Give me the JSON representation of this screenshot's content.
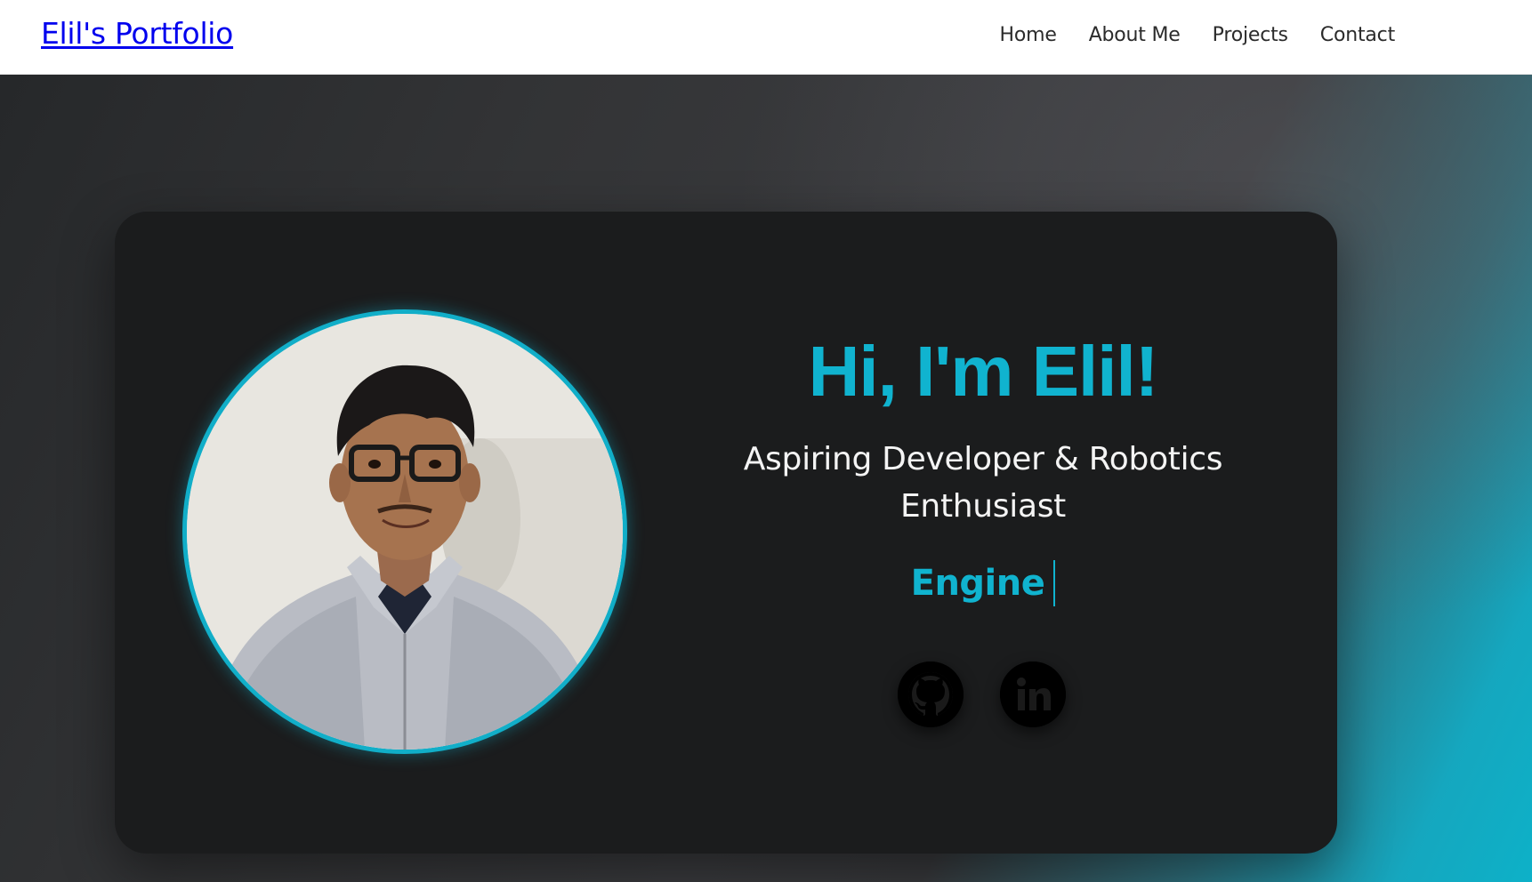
{
  "header": {
    "brand": "Elil's Portfolio",
    "nav": [
      "Home",
      "About Me",
      "Projects",
      "Contact"
    ]
  },
  "hero": {
    "greeting": "Hi, I'm Elil!",
    "tagline_line1": "Aspiring Developer & Robotics",
    "tagline_line2": "Enthusiast",
    "typed_text": "Engine"
  },
  "social": [
    {
      "icon": "github-icon"
    },
    {
      "icon": "linkedin-icon"
    }
  ],
  "colors": {
    "accent": "#10b3cf",
    "card_bg": "#1b1c1d",
    "link": "#0000ee"
  }
}
